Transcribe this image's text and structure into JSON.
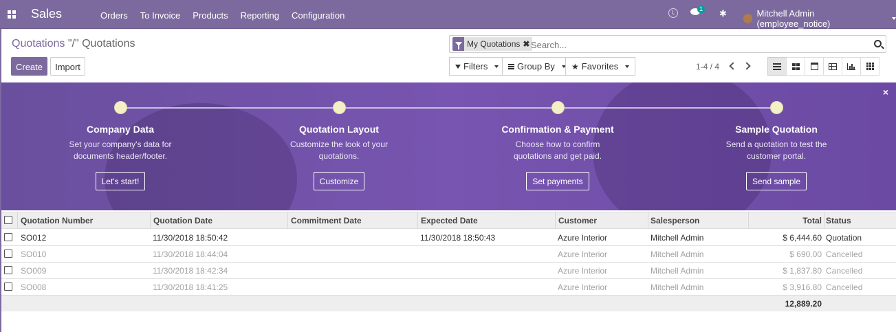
{
  "navbar": {
    "app_name": "Sales",
    "menu": [
      "Orders",
      "To Invoice",
      "Products",
      "Reporting",
      "Configuration"
    ],
    "chat_badge": "1",
    "user_name": "Mitchell Admin (employee_notice)"
  },
  "breadcrumb": {
    "parent": "Quotations",
    "separator": " \"/\" ",
    "current": "Quotations"
  },
  "buttons": {
    "create": "Create",
    "import": "Import"
  },
  "search": {
    "facet_value": "My Quotations",
    "facet_remove": "✖",
    "placeholder": "Search..."
  },
  "filters": {
    "filters_label": "Filters",
    "groupby_label": "Group By",
    "favorites_label": "Favorites"
  },
  "pager": {
    "range": "1-4 / 4"
  },
  "onboarding": {
    "close": "×",
    "steps": [
      {
        "title": "Company Data",
        "desc": "Set your company's data for documents header/footer.",
        "button": "Let's start!"
      },
      {
        "title": "Quotation Layout",
        "desc": "Customize the look of your quotations.",
        "button": "Customize"
      },
      {
        "title": "Confirmation & Payment",
        "desc": "Choose how to confirm quotations and get paid.",
        "button": "Set payments"
      },
      {
        "title": "Sample Quotation",
        "desc": "Send a quotation to test the customer portal.",
        "button": "Send sample"
      }
    ]
  },
  "table": {
    "headers": {
      "number": "Quotation Number",
      "date": "Quotation Date",
      "commitment": "Commitment Date",
      "expected": "Expected Date",
      "customer": "Customer",
      "salesperson": "Salesperson",
      "total": "Total",
      "status": "Status"
    },
    "rows": [
      {
        "number": "SO012",
        "date": "11/30/2018 18:50:42",
        "commitment": "",
        "expected": "11/30/2018 18:50:43",
        "customer": "Azure Interior",
        "salesperson": "Mitchell Admin",
        "total": "$ 6,444.60",
        "status": "Quotation"
      },
      {
        "number": "SO010",
        "date": "11/30/2018 18:44:04",
        "commitment": "",
        "expected": "",
        "customer": "Azure Interior",
        "salesperson": "Mitchell Admin",
        "total": "$ 690.00",
        "status": "Cancelled"
      },
      {
        "number": "SO009",
        "date": "11/30/2018 18:42:34",
        "commitment": "",
        "expected": "",
        "customer": "Azure Interior",
        "salesperson": "Mitchell Admin",
        "total": "$ 1,837.80",
        "status": "Cancelled"
      },
      {
        "number": "SO008",
        "date": "11/30/2018 18:41:25",
        "commitment": "",
        "expected": "",
        "customer": "Azure Interior",
        "salesperson": "Mitchell Admin",
        "total": "$ 3,916.80",
        "status": "Cancelled"
      }
    ],
    "grand_total": "12,889.20"
  },
  "colors": {
    "brand": "#7c6a9e",
    "banner": "#7755b0",
    "muted_text": "#a3a3a3"
  }
}
